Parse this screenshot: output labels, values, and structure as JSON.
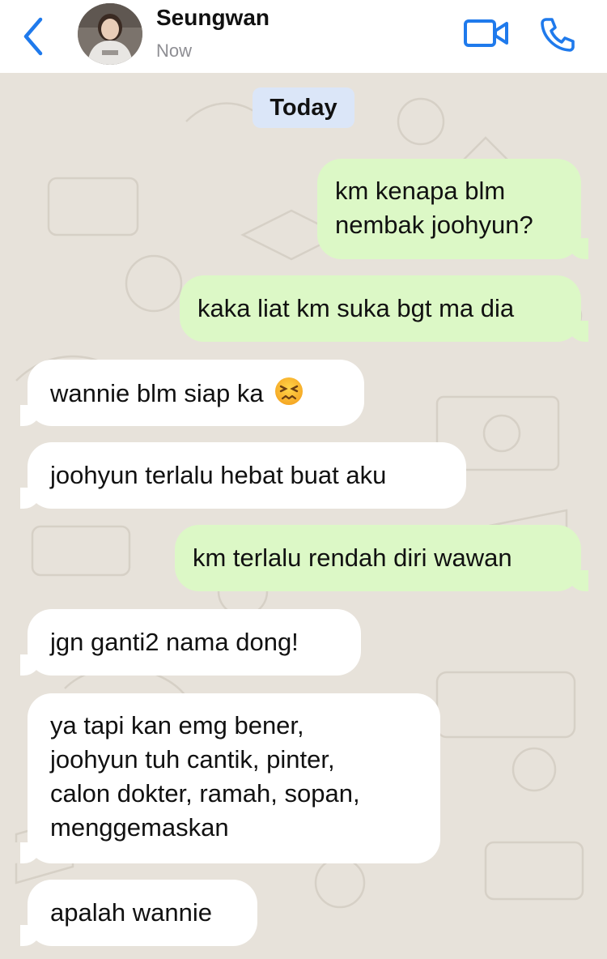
{
  "header": {
    "contact_name": "Seungwan",
    "status": "Now",
    "icons": {
      "back": "chevron-left-icon",
      "video": "video-camera-icon",
      "call": "phone-icon"
    },
    "accent_color": "#1f7aec"
  },
  "chat": {
    "date_label": "Today",
    "messages": [
      {
        "direction": "out",
        "text": "km kenapa blm\nnembak joohyun?"
      },
      {
        "direction": "out",
        "text": "kaka liat km suka bgt ma dia"
      },
      {
        "direction": "in",
        "text": "wannie blm siap ka",
        "emoji": "confounded-face-emoji"
      },
      {
        "direction": "in",
        "text": "joohyun terlalu hebat buat aku"
      },
      {
        "direction": "out",
        "text": "km terlalu rendah diri wawan"
      },
      {
        "direction": "in",
        "text": "jgn ganti2 nama dong!"
      },
      {
        "direction": "in",
        "text": "ya tapi kan emg bener,\njoohyun tuh cantik, pinter,\ncalon dokter, ramah, sopan,\nmenggemaskan"
      },
      {
        "direction": "in",
        "text": "apalah wannie"
      }
    ],
    "colors": {
      "sent_bubble": "#dcf8c6",
      "received_bubble": "#ffffff",
      "wallpaper": "#e7e2da",
      "date_chip": "#dbe6f8"
    }
  }
}
